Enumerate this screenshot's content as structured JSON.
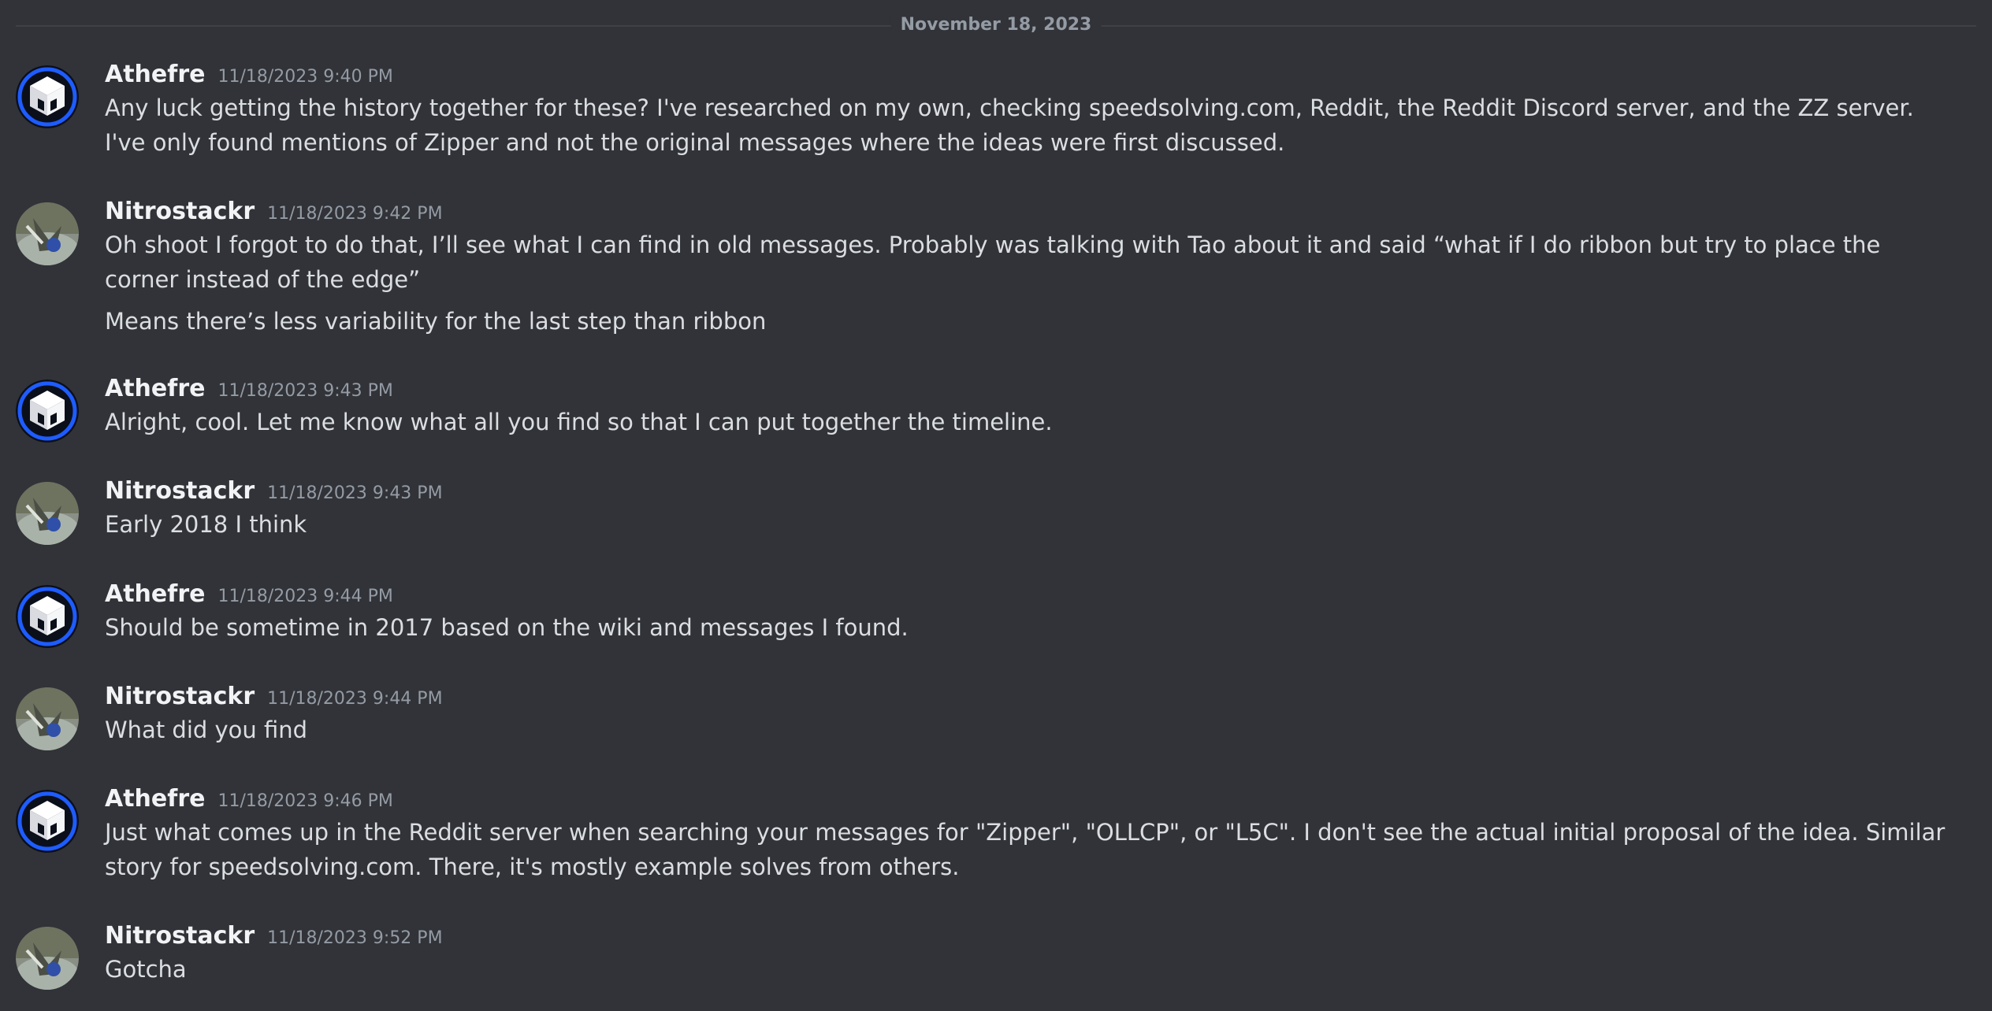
{
  "divider": {
    "date": "November 18, 2023"
  },
  "colors": {
    "background": "#313338",
    "username": "#f2f3f5",
    "timestamp": "#949ba4",
    "message_text": "#dbdee1",
    "athefre_avatar_ring": "#1e5cff"
  },
  "messages": [
    {
      "author": "Athefre",
      "avatar_icon": "cube-logo-icon",
      "time": "11/18/2023 9:40 PM",
      "lines": [
        "Any luck getting the history together for these? I've researched on my own, checking speedsolving.com, Reddit, the Reddit Discord server, and the ZZ server. I've only found mentions of Zipper and not the original messages where the ideas were first discussed."
      ]
    },
    {
      "author": "Nitrostackr",
      "avatar_icon": "photo-avatar-icon",
      "time": "11/18/2023 9:42 PM",
      "lines": [
        "Oh shoot I forgot to do that, I’ll see what I can find in old messages. Probably was talking with Tao about it and said “what if I do ribbon but try to place the corner instead of the edge”",
        "Means there’s less variability for the last step than ribbon"
      ]
    },
    {
      "author": "Athefre",
      "avatar_icon": "cube-logo-icon",
      "time": "11/18/2023 9:43 PM",
      "lines": [
        "Alright, cool. Let me know what all you find so that I can put together the timeline."
      ]
    },
    {
      "author": "Nitrostackr",
      "avatar_icon": "photo-avatar-icon",
      "time": "11/18/2023 9:43 PM",
      "lines": [
        "Early 2018 I think"
      ]
    },
    {
      "author": "Athefre",
      "avatar_icon": "cube-logo-icon",
      "time": "11/18/2023 9:44 PM",
      "lines": [
        "Should be sometime in 2017 based on the wiki and messages I found."
      ]
    },
    {
      "author": "Nitrostackr",
      "avatar_icon": "photo-avatar-icon",
      "time": "11/18/2023 9:44 PM",
      "lines": [
        "What did you find"
      ]
    },
    {
      "author": "Athefre",
      "avatar_icon": "cube-logo-icon",
      "time": "11/18/2023 9:46 PM",
      "lines": [
        "Just what comes up in the Reddit server when searching your messages for \"Zipper\", \"OLLCP\", or \"L5C\". I don't see the actual initial proposal of the idea. Similar story for speedsolving.com. There, it's mostly example solves from others."
      ]
    },
    {
      "author": "Nitrostackr",
      "avatar_icon": "photo-avatar-icon",
      "time": "11/18/2023 9:52 PM",
      "lines": [
        "Gotcha"
      ]
    }
  ]
}
